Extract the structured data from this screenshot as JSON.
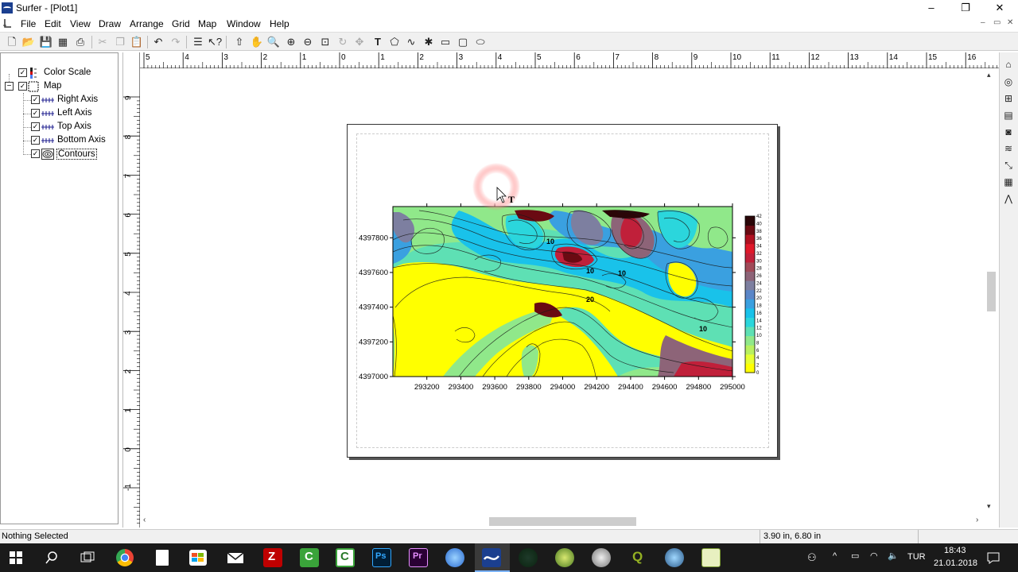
{
  "window": {
    "title": "Surfer - [Plot1]",
    "controls": {
      "minimize": "–",
      "restore": "❐",
      "close": "✕"
    }
  },
  "menu": {
    "items": [
      "File",
      "Edit",
      "View",
      "Draw",
      "Arrange",
      "Grid",
      "Map",
      "Window",
      "Help"
    ],
    "mdi_controls": {
      "minimize": "–",
      "restore": "▭",
      "close": "✕"
    }
  },
  "toolbar": {
    "icons": [
      "new-icon",
      "open-icon",
      "save-icon",
      "worksheet-icon",
      "print-icon",
      "cut-icon",
      "copy-icon",
      "paste-icon",
      "undo-icon",
      "redo-icon",
      "object-manager-icon",
      "help-pointer-icon",
      "select-arrow-icon",
      "pan-hand-icon",
      "zoom-realtime-icon",
      "zoom-in-icon",
      "zoom-out-icon",
      "zoom-rectangle-icon",
      "rotate-icon",
      "reshape-icon",
      "text-icon",
      "polygon-icon",
      "polyline-icon",
      "symbol-icon",
      "rectangle-icon",
      "rounded-rectangle-icon",
      "ellipse-icon"
    ]
  },
  "object_manager": {
    "items": [
      {
        "label": "Color Scale",
        "checked": true,
        "level": 0,
        "icon": "color-scale-icon"
      },
      {
        "label": "Map",
        "checked": true,
        "level": 0,
        "icon": "map-frame-icon",
        "expanded": true
      },
      {
        "label": "Right Axis",
        "checked": true,
        "level": 1,
        "icon": "axis-icon"
      },
      {
        "label": "Left Axis",
        "checked": true,
        "level": 1,
        "icon": "axis-icon"
      },
      {
        "label": "Top Axis",
        "checked": true,
        "level": 1,
        "icon": "axis-icon"
      },
      {
        "label": "Bottom Axis",
        "checked": true,
        "level": 1,
        "icon": "axis-icon"
      },
      {
        "label": "Contours",
        "checked": true,
        "level": 1,
        "icon": "contour-layer-icon",
        "focused": true
      }
    ]
  },
  "rulers": {
    "horizontal_labels": [
      "5",
      "4",
      "3",
      "2",
      "1",
      "0",
      "1",
      "2",
      "3",
      "4",
      "5",
      "6",
      "7",
      "8",
      "9",
      "10",
      "11",
      "12",
      "13",
      "14",
      "15",
      "16"
    ],
    "vertical_labels": [
      "9",
      "8",
      "7",
      "6",
      "5",
      "4",
      "3",
      "2",
      "1",
      "0",
      "-1"
    ]
  },
  "chart_data": {
    "type": "heatmap",
    "title": "",
    "xlabel": "",
    "ylabel": "",
    "x_ticks": [
      "293200",
      "293400",
      "293600",
      "293800",
      "294000",
      "294200",
      "294400",
      "294600",
      "294800",
      "295000"
    ],
    "y_ticks": [
      "4397000",
      "4397200",
      "4397400",
      "4397600",
      "4397800"
    ],
    "xlim": [
      293000,
      295000
    ],
    "ylim": [
      4397000,
      4397980
    ],
    "contour_labels": [
      "10",
      "10",
      "20",
      "10",
      "10"
    ],
    "color_scale": {
      "ticks": [
        "42",
        "40",
        "38",
        "36",
        "34",
        "32",
        "30",
        "28",
        "26",
        "24",
        "22",
        "20",
        "18",
        "16",
        "14",
        "12",
        "10",
        "8",
        "6",
        "4",
        "2",
        "0"
      ],
      "colors": [
        "#ffff00",
        "#e6ff33",
        "#b8f060",
        "#90e88a",
        "#5ee0b4",
        "#2bd6dc",
        "#19c2ea",
        "#3aa0e0",
        "#5a86c8",
        "#7d7fa0",
        "#8d6478",
        "#a04a58",
        "#c0203a",
        "#e0182a",
        "#b01020",
        "#6a0a12",
        "#2a0608"
      ],
      "range": [
        0,
        42
      ]
    }
  },
  "right_tools": [
    "object-manager-tool-icon",
    "property-tool-icon",
    "map-frame-tool-icon",
    "legend-tool-icon",
    "camera-icon",
    "contour-map-icon",
    "post-map-icon",
    "3d-surface-icon",
    "vector-icon"
  ],
  "status": {
    "left": "Nothing Selected",
    "coords": "3.90 in, 6.80 in"
  },
  "taskbar": {
    "apps": [
      "start-icon",
      "search-icon",
      "task-view-icon",
      "chrome-icon",
      "file-icon",
      "store-icon",
      "mail-icon",
      "filezilla-icon",
      "camtasia-icon",
      "camtasia-editor-icon",
      "photoshop-icon",
      "premiere-icon",
      "unknown-app-icon",
      "surfer-icon",
      "app-icon-1",
      "app-icon-2",
      "app-icon-3",
      "qgis-icon",
      "app-icon-4",
      "app-icon-5"
    ],
    "tray": {
      "lang": "TUR",
      "time": "18:43",
      "date": "21.01.2018"
    }
  }
}
